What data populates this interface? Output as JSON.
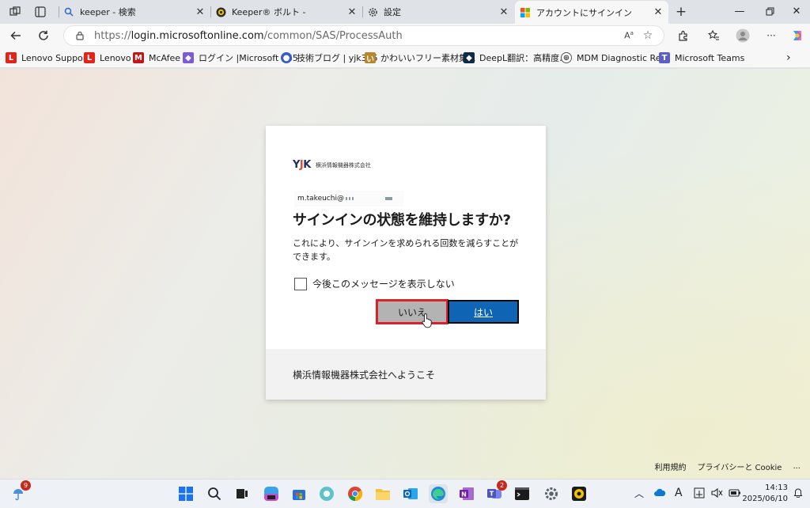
{
  "tabs": [
    {
      "title": "keeper - 検索",
      "icon": "search-icon"
    },
    {
      "title": "Keeper® ボルト -",
      "icon": "keeper-icon"
    },
    {
      "title": "設定",
      "icon": "gear-icon"
    },
    {
      "title": "アカウントにサインイン",
      "icon": "microsoft-icon"
    }
  ],
  "address": {
    "prefix": "https://",
    "host": "login.microsoftonline.com",
    "path": "/common/SAS/ProcessAuth"
  },
  "favorites": [
    {
      "label": "Lenovo Support",
      "color": "#e2231a",
      "glyph": "L"
    },
    {
      "label": "Lenovo",
      "color": "#e2231a",
      "glyph": "L"
    },
    {
      "label": "McAfee",
      "color": "#c01818",
      "glyph": "M"
    },
    {
      "label": "ログイン |Microsoft 365",
      "color": "#7b5cd6",
      "glyph": "◆"
    },
    {
      "label": "技術ブログ | yjk365",
      "color": "#3a5bc7",
      "glyph": "●"
    },
    {
      "label": "かわいいフリー素材集...",
      "color": "#b8862c",
      "glyph": "い"
    },
    {
      "label": "DeepL翻訳：高精度...",
      "color": "#0f2b46",
      "glyph": "◆"
    },
    {
      "label": "MDM Diagnostic Re...",
      "color": "#555555",
      "glyph": "⊕"
    },
    {
      "label": "Microsoft Teams",
      "color": "#5b5fc7",
      "glyph": "T"
    }
  ],
  "card": {
    "company_logo_text": "横浜情報機器株式会社",
    "identity": "m.takeuchi@",
    "title": "サインインの状態を維持しますか?",
    "description": "これにより、サインインを求められる回数を減らすことができます。",
    "checkbox_label": "今後このメッセージを表示しない",
    "no_label": "いいえ",
    "yes_label": "はい",
    "footer": "横浜情報機器株式会社へようこそ"
  },
  "page_footer": {
    "terms": "利用規約",
    "privacy": "プライバシーと Cookie",
    "more": "..."
  },
  "taskbar": {
    "weather_badge": "9",
    "teams_badge": "2",
    "clock_time": "14:13",
    "clock_date": "2025/06/10"
  },
  "colors": {
    "primary_button": "#0f64b4",
    "highlight_border": "#d8232a",
    "secondary_button": "#b3b3b3"
  }
}
